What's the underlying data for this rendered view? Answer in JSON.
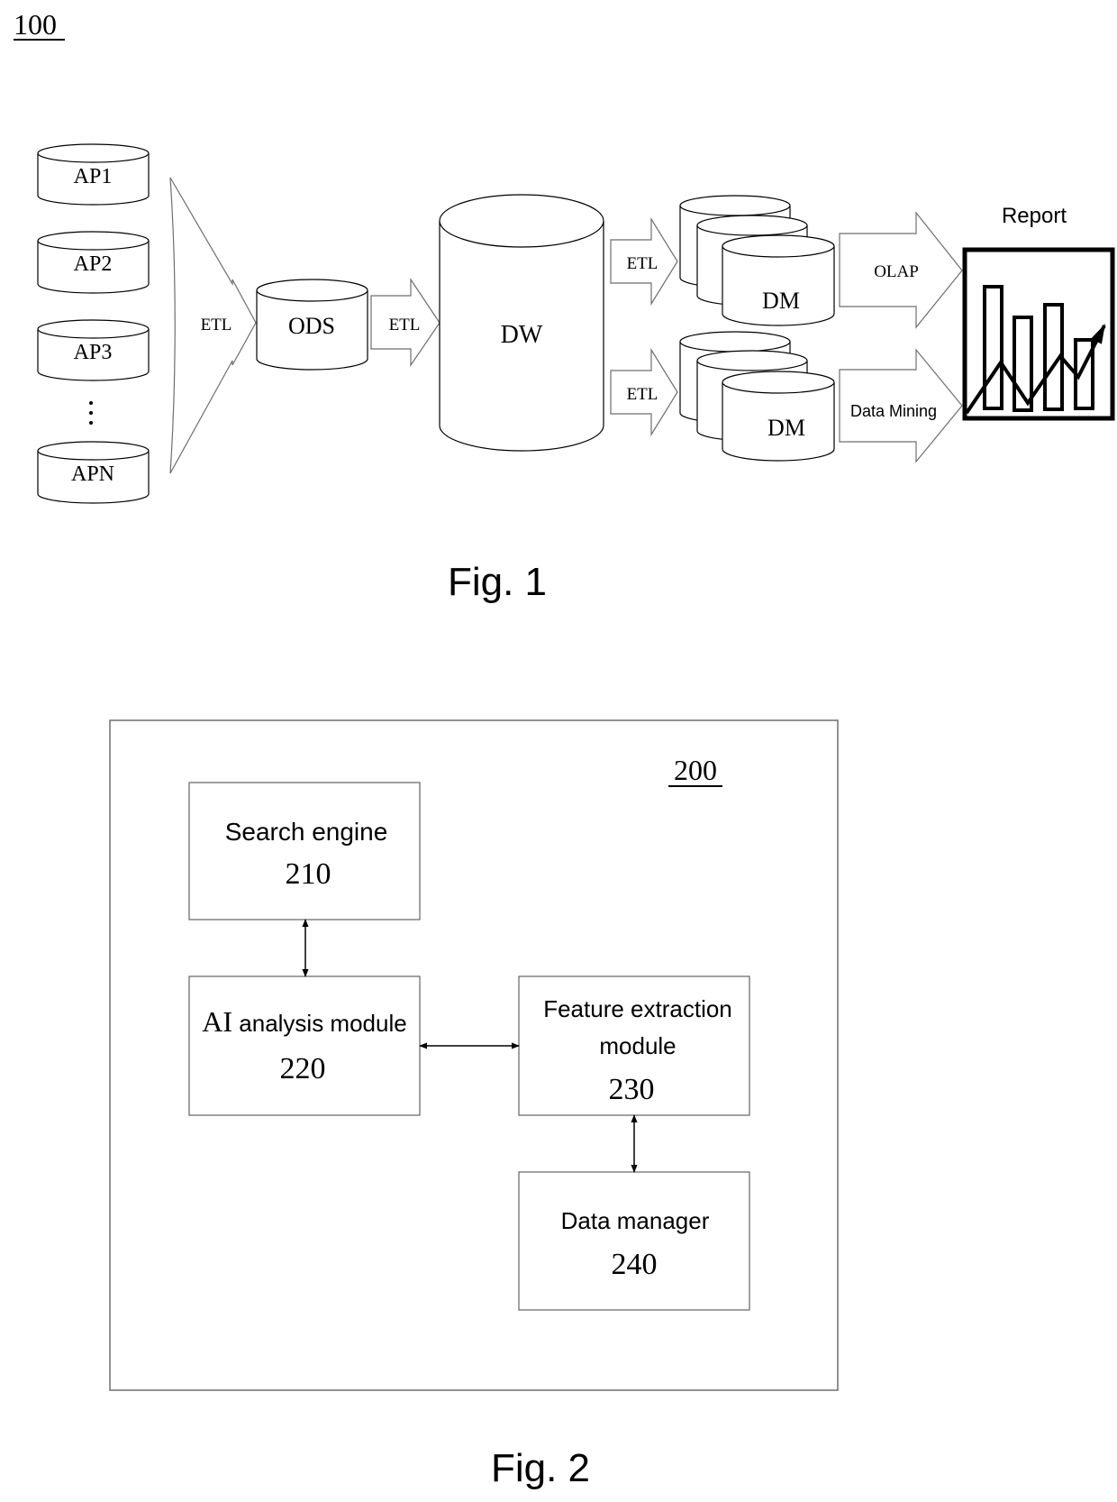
{
  "fig1": {
    "ref_label": "100",
    "caption": "Fig. 1",
    "sources": [
      {
        "label": "AP1"
      },
      {
        "label": "AP2"
      },
      {
        "label": "AP3"
      },
      {
        "label": "APN"
      }
    ],
    "ellipsis": "⋮",
    "etl_label_1": "ETL",
    "ods_label": "ODS",
    "etl_label_2": "ETL",
    "dw_label": "DW",
    "etl_label_3": "ETL",
    "etl_label_4": "ETL",
    "dm_label_top": "DM",
    "dm_label_bottom": "DM",
    "olap_label": "OLAP",
    "data_mining_label": "Data Mining",
    "report_label": "Report",
    "report_icon": "bar-chart-with-trend-arrow-icon"
  },
  "fig2": {
    "ref_label": "200",
    "caption": "Fig. 2",
    "modules": {
      "search_engine": {
        "name": "Search engine",
        "number": "210"
      },
      "ai_analysis": {
        "name_prefix": "AI",
        "name": " analysis module",
        "number": "220"
      },
      "feature_extraction": {
        "name_line1": "Feature extraction",
        "name_line2": "module",
        "number": "230"
      },
      "data_manager": {
        "name": "Data manager",
        "number": "240"
      }
    },
    "connections": [
      {
        "from": "210",
        "to": "220",
        "type": "bidirectional"
      },
      {
        "from": "220",
        "to": "230",
        "type": "bidirectional"
      },
      {
        "from": "230",
        "to": "240",
        "type": "bidirectional"
      }
    ]
  }
}
